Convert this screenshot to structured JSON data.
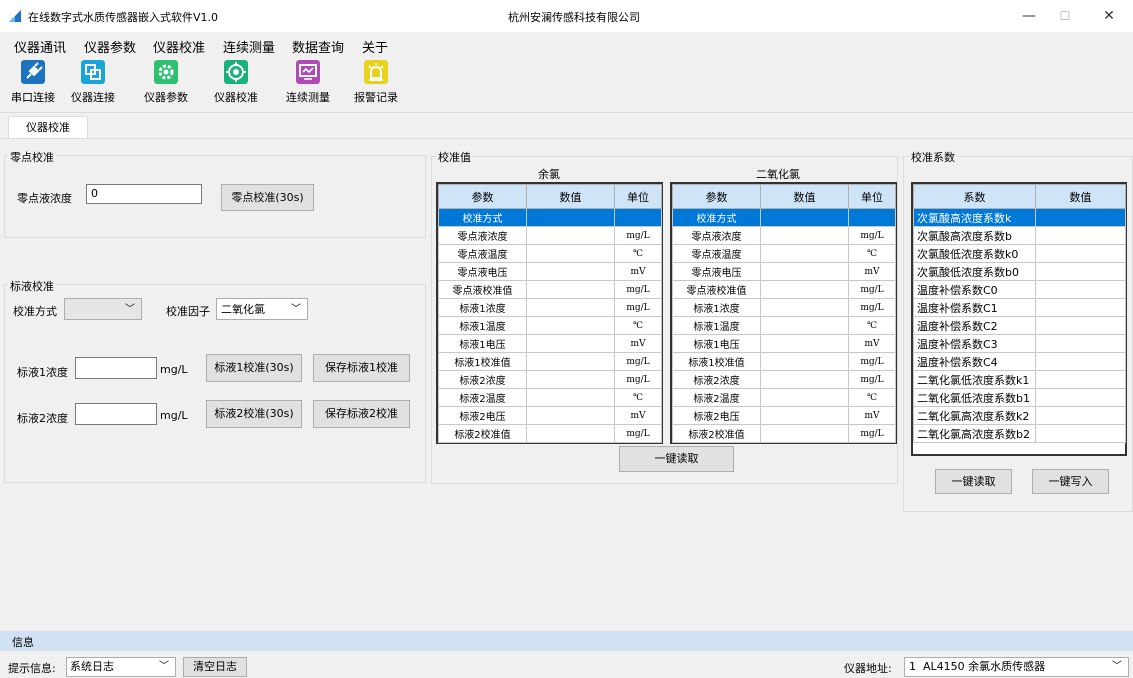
{
  "window": {
    "title": "在线数字式水质传感器嵌入式软件V1.0",
    "company": "杭州安澜传感科技有限公司",
    "min_glyph": "—",
    "max_glyph": "☐",
    "close_glyph": "✕"
  },
  "menu": [
    "仪器通讯",
    "仪器参数",
    "仪器校准",
    "连续测量",
    "数据查询",
    "关于"
  ],
  "toolbar": [
    {
      "label": "串口连接",
      "icon": "plug-icon",
      "color": "#1e73be"
    },
    {
      "label": "仪器连接",
      "icon": "link-icon",
      "color": "#1aa5d8"
    },
    {
      "label": "仪器参数",
      "icon": "gear-icon",
      "color": "#2fbf71"
    },
    {
      "label": "仪器校准",
      "icon": "target-icon",
      "color": "#18b37a"
    },
    {
      "label": "连续测量",
      "icon": "monitor-icon",
      "color": "#b04ab8"
    },
    {
      "label": "报警记录",
      "icon": "alarm-icon",
      "color": "#e8d11c"
    }
  ],
  "tab": "仪器校准",
  "zero_cal": {
    "title": "零点校准",
    "label": "零点液浓度",
    "value": "0",
    "button": "零点校准(30s)"
  },
  "std_cal": {
    "title": "标液校准",
    "method_label": "校准方式",
    "method_value": "",
    "factor_label": "校准因子",
    "factor_value": "二氧化氯",
    "std1_label": "标液1浓度",
    "std1_value": "",
    "std2_label": "标液2浓度",
    "std2_value": "",
    "unit": "mg/L",
    "std1_button": "标液1校准(30s)",
    "std1_save": "保存标液1校准",
    "std2_button": "标液2校准(30s)",
    "std2_save": "保存标液2校准"
  },
  "cal_values": {
    "title": "校准值",
    "headers": [
      "参数",
      "数值",
      "单位"
    ],
    "read_button": "一键读取",
    "tables": [
      {
        "name": "余氯",
        "rows": [
          {
            "param": "校准方式",
            "value": "",
            "unit": ""
          },
          {
            "param": "零点液浓度",
            "value": "",
            "unit": "mg/L"
          },
          {
            "param": "零点液温度",
            "value": "",
            "unit": "℃"
          },
          {
            "param": "零点液电压",
            "value": "",
            "unit": "mV"
          },
          {
            "param": "零点液校准值",
            "value": "",
            "unit": "mg/L"
          },
          {
            "param": "标液1浓度",
            "value": "",
            "unit": "mg/L"
          },
          {
            "param": "标液1温度",
            "value": "",
            "unit": "℃"
          },
          {
            "param": "标液1电压",
            "value": "",
            "unit": "mV"
          },
          {
            "param": "标液1校准值",
            "value": "",
            "unit": "mg/L"
          },
          {
            "param": "标液2浓度",
            "value": "",
            "unit": "mg/L"
          },
          {
            "param": "标液2温度",
            "value": "",
            "unit": "℃"
          },
          {
            "param": "标液2电压",
            "value": "",
            "unit": "mV"
          },
          {
            "param": "标液2校准值",
            "value": "",
            "unit": "mg/L"
          }
        ]
      },
      {
        "name": "二氧化氯",
        "rows": [
          {
            "param": "校准方式",
            "value": "",
            "unit": ""
          },
          {
            "param": "零点液浓度",
            "value": "",
            "unit": "mg/L"
          },
          {
            "param": "零点液温度",
            "value": "",
            "unit": "℃"
          },
          {
            "param": "零点液电压",
            "value": "",
            "unit": "mV"
          },
          {
            "param": "零点液校准值",
            "value": "",
            "unit": "mg/L"
          },
          {
            "param": "标液1浓度",
            "value": "",
            "unit": "mg/L"
          },
          {
            "param": "标液1温度",
            "value": "",
            "unit": "℃"
          },
          {
            "param": "标液1电压",
            "value": "",
            "unit": "mV"
          },
          {
            "param": "标液1校准值",
            "value": "",
            "unit": "mg/L"
          },
          {
            "param": "标液2浓度",
            "value": "",
            "unit": "mg/L"
          },
          {
            "param": "标液2温度",
            "value": "",
            "unit": "℃"
          },
          {
            "param": "标液2电压",
            "value": "",
            "unit": "mV"
          },
          {
            "param": "标液2校准值",
            "value": "",
            "unit": "mg/L"
          }
        ]
      }
    ]
  },
  "coefficients": {
    "title": "校准系数",
    "headers": [
      "系数",
      "数值"
    ],
    "rows": [
      {
        "name": "次氯酸高浓度系数k",
        "value": ""
      },
      {
        "name": "次氯酸高浓度系数b",
        "value": ""
      },
      {
        "name": "次氯酸低浓度系数k0",
        "value": ""
      },
      {
        "name": "次氯酸低浓度系数b0",
        "value": ""
      },
      {
        "name": "温度补偿系数C0",
        "value": ""
      },
      {
        "name": "温度补偿系数C1",
        "value": ""
      },
      {
        "name": "温度补偿系数C2",
        "value": ""
      },
      {
        "name": "温度补偿系数C3",
        "value": ""
      },
      {
        "name": "温度补偿系数C4",
        "value": ""
      },
      {
        "name": "二氧化氯低浓度系数k1",
        "value": ""
      },
      {
        "name": "二氧化氯低浓度系数b1",
        "value": ""
      },
      {
        "name": "二氧化氯高浓度系数k2",
        "value": ""
      },
      {
        "name": "二氧化氯高浓度系数b2",
        "value": ""
      }
    ],
    "read_button": "一键读取",
    "write_button": "一键写入"
  },
  "info": {
    "label": "信息"
  },
  "status": {
    "hint_label": "提示信息:",
    "log_select": "系统日志",
    "clear_button": "清空日志",
    "addr_label": "仪器地址:",
    "addr_value": "1  AL4150 余氯水质传感器"
  },
  "selected_color": "#0078d7",
  "header_color": "#cfe4f7"
}
